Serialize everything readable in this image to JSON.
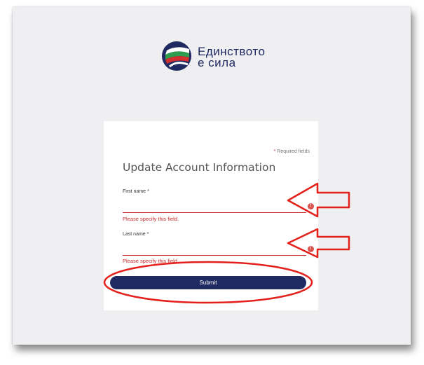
{
  "brand": {
    "line1": "Единството",
    "line2": "е сила"
  },
  "form": {
    "required_note": "Required fields",
    "required_star": "*",
    "title": "Update Account Information",
    "first_name": {
      "label": "First name *",
      "value": "",
      "error": "Please specify this field."
    },
    "last_name": {
      "label": "Last name *",
      "value": "",
      "error": "Please specify this field."
    },
    "error_icon": "!",
    "submit_label": "Submit"
  },
  "colors": {
    "brand_navy": "#1f2a63",
    "error_red": "#c62828",
    "annotation_red": "#e3201b",
    "background": "#efeef0"
  },
  "icons": {
    "logo": "ednistvoto-logo-icon",
    "field_error": "error-circle-icon",
    "annotation": "arrow-left-icon"
  }
}
